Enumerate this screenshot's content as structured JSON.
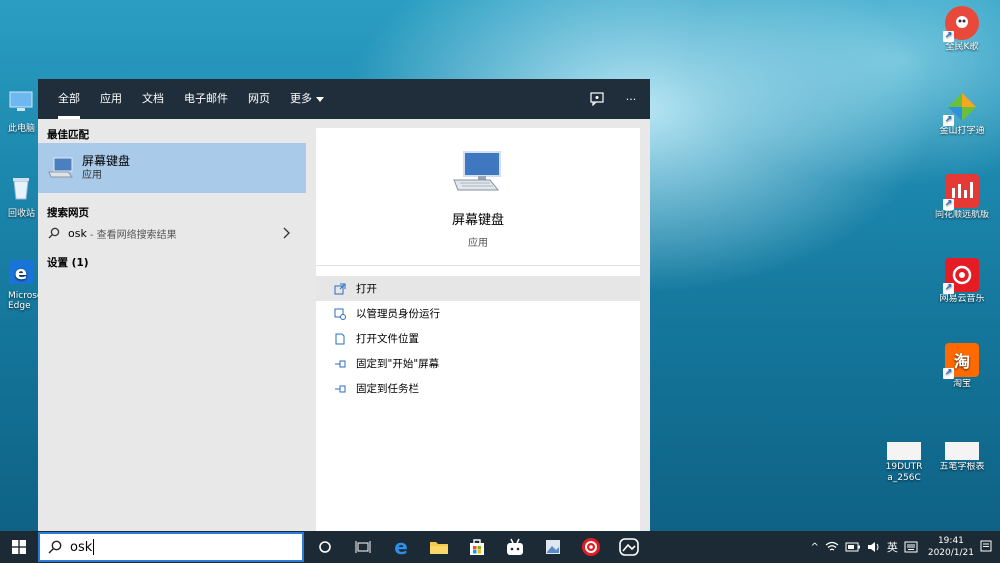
{
  "desktop": {
    "left_icons": [
      {
        "label": "此电脑",
        "icon": "this-pc-icon"
      },
      {
        "label": "回收站",
        "icon": "recycle-bin-icon"
      },
      {
        "label": "Microsoft Edge",
        "icon": "edge-icon"
      }
    ],
    "right_icons": [
      {
        "label": "全民K歌",
        "icon": "karaoke-app-icon",
        "color": "#e8493b"
      },
      {
        "label": "金山打字通",
        "icon": "kingsoft-typing-icon",
        "color": "#6cbf3b"
      },
      {
        "label": "同花顺远航版",
        "icon": "stock-app-icon",
        "color": "#e53935"
      },
      {
        "label": "网易云音乐",
        "icon": "netease-music-icon",
        "color": "#e51c23"
      },
      {
        "label": "淘宝",
        "icon": "taobao-icon",
        "color": "#ff6a00",
        "glyph": "淘"
      },
      {
        "label": "19DUTR a_256C",
        "icon": "image-file-icon"
      },
      {
        "label": "五笔字根表",
        "icon": "image-file-icon"
      }
    ]
  },
  "search_panel": {
    "tabs": [
      {
        "label": "全部",
        "active": true
      },
      {
        "label": "应用"
      },
      {
        "label": "文档"
      },
      {
        "label": "电子邮件"
      },
      {
        "label": "网页"
      },
      {
        "label": "更多"
      }
    ],
    "feedback_icon": "feedback-icon",
    "more_options": "···",
    "best_match_heading": "最佳匹配",
    "best_match": {
      "title": "屏幕键盘",
      "subtitle": "应用"
    },
    "web_heading": "搜索网页",
    "web_result": {
      "query": "osk",
      "hint": "- 查看网络搜索结果"
    },
    "settings_heading": "设置 (1)",
    "detail": {
      "title": "屏幕键盘",
      "subtitle": "应用",
      "actions": [
        {
          "label": "打开",
          "icon": "open-icon"
        },
        {
          "label": "以管理员身份运行",
          "icon": "run-as-admin-icon"
        },
        {
          "label": "打开文件位置",
          "icon": "file-location-icon"
        },
        {
          "label": "固定到\"开始\"屏幕",
          "icon": "pin-icon"
        },
        {
          "label": "固定到任务栏",
          "icon": "pin-icon"
        }
      ]
    }
  },
  "taskbar": {
    "search_value": "osk",
    "tray": {
      "chevron": "^",
      "input_method": "英",
      "time": "19:41",
      "date": "2020/1/21"
    }
  },
  "colors": {
    "panel_header": "#1f2e3a",
    "best_match_bg": "#aacaea",
    "taskbar": "#1b2a35",
    "accent": "#2d7bd4"
  }
}
